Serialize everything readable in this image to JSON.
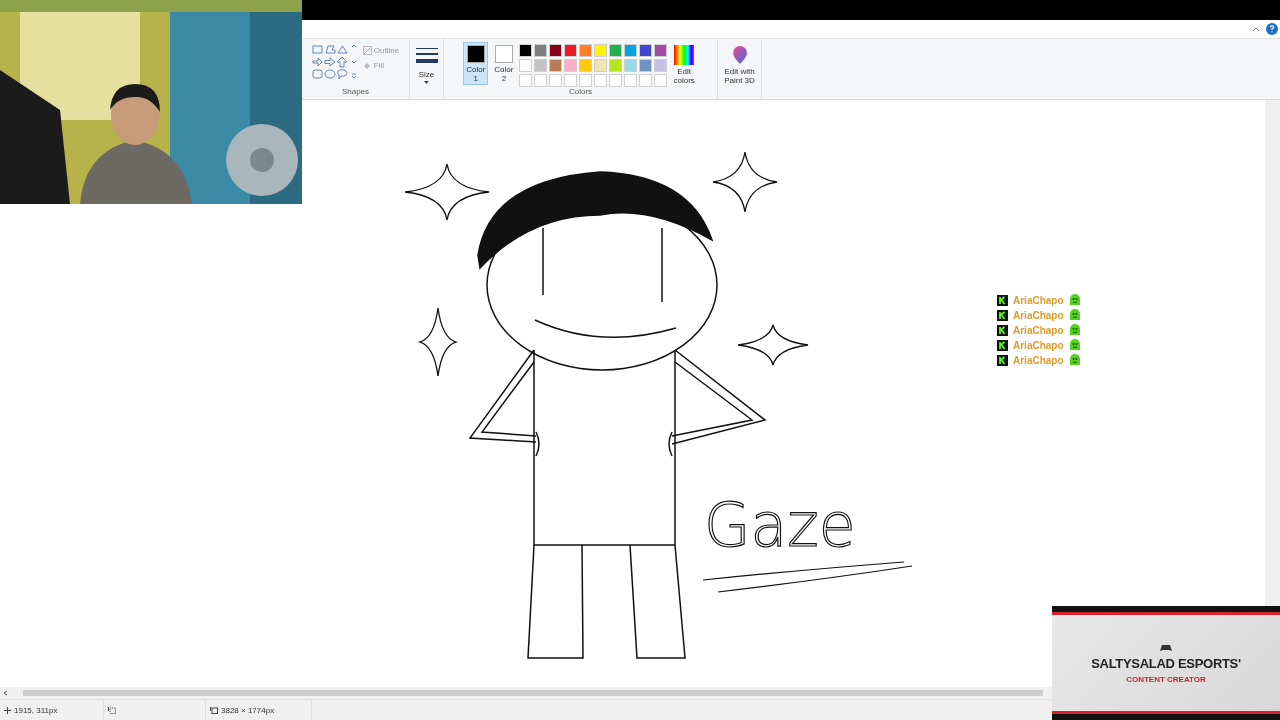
{
  "ribbon": {
    "shapes": {
      "label": "Shapes",
      "outline": "Outline",
      "fill": "Fill"
    },
    "size": {
      "label": "Size"
    },
    "colors": {
      "label": "Colors",
      "active": [
        {
          "lines": [
            "Color",
            "1"
          ],
          "color": "#000000",
          "selected": true
        },
        {
          "lines": [
            "Color",
            "2"
          ],
          "color": "#ffffff",
          "selected": false
        }
      ],
      "palette": [
        {
          "color": "#000000"
        },
        {
          "color": "#7f7f7f"
        },
        {
          "color": "#880015"
        },
        {
          "color": "#ed1c24"
        },
        {
          "color": "#ff7f27"
        },
        {
          "color": "#fff200"
        },
        {
          "color": "#22b14c"
        },
        {
          "color": "#00a2e8"
        },
        {
          "color": "#3f48cc"
        },
        {
          "color": "#a349a4"
        },
        {
          "color": "#ffffff"
        },
        {
          "color": "#c3c3c3"
        },
        {
          "color": "#b97a57"
        },
        {
          "color": "#ffaec9"
        },
        {
          "color": "#ffc90e"
        },
        {
          "color": "#efe4b0"
        },
        {
          "color": "#b5e61d"
        },
        {
          "color": "#99d9ea"
        },
        {
          "color": "#7092be"
        },
        {
          "color": "#c8bfe7"
        }
      ],
      "edit": [
        "Edit",
        "colors"
      ]
    },
    "paint3d": [
      "Edit with",
      "Paint 3D"
    ]
  },
  "canvas": {
    "word": "Gaze"
  },
  "chat": [
    {
      "user": "AriaChapo"
    },
    {
      "user": "AriaChapo"
    },
    {
      "user": "AriaChapo"
    },
    {
      "user": "AriaChapo"
    },
    {
      "user": "AriaChapo"
    }
  ],
  "status_bar": {
    "position": "1915, 311px",
    "size": "3828 × 1774px"
  },
  "banner": {
    "title": "SALTYSALAD ESPORTS'",
    "subtitle": "CONTENT CREATOR"
  }
}
